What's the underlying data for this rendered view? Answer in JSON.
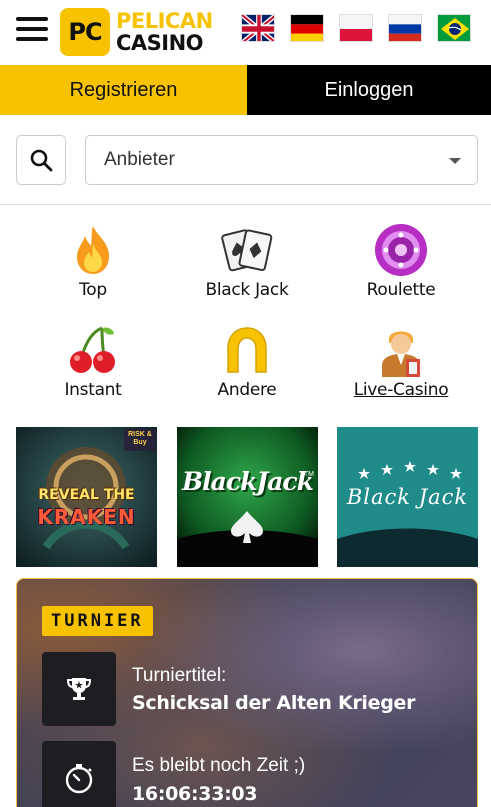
{
  "header": {
    "brand_abbrev": "PC",
    "brand_line1": "PELICAN",
    "brand_line2": "CASINO",
    "languages": [
      {
        "name": "english-flag-icon"
      },
      {
        "name": "german-flag-icon"
      },
      {
        "name": "polish-flag-icon"
      },
      {
        "name": "russian-flag-icon"
      },
      {
        "name": "brazil-flag-icon"
      }
    ]
  },
  "auth": {
    "register_label": "Registrieren",
    "login_label": "Einloggen"
  },
  "filter": {
    "provider_selected": "Anbieter"
  },
  "categories": [
    {
      "label": "Top",
      "icon": "flame-icon"
    },
    {
      "label": "Black Jack",
      "icon": "playing-cards-icon"
    },
    {
      "label": "Roulette",
      "icon": "roulette-icon"
    },
    {
      "label": "Instant",
      "icon": "cherries-icon"
    },
    {
      "label": "Andere",
      "icon": "horseshoe-icon"
    },
    {
      "label": "Live-Casino",
      "icon": "dealer-icon"
    }
  ],
  "games": [
    {
      "title_line1": "REVEAL THE",
      "title_line2": "KRAKEN",
      "badge": "RISK & Buy"
    },
    {
      "title": "BlackJack",
      "tm": "TM"
    },
    {
      "title": "Black Jack"
    }
  ],
  "tournament": {
    "badge": "TURNIER",
    "title_label": "Turniertitel:",
    "title_value": "Schicksal der Alten Krieger",
    "time_label": "Es bleibt noch Zeit ;)",
    "time_value": "16:06:33:03"
  },
  "colors": {
    "accent": "#f7c200",
    "dark": "#000000"
  }
}
